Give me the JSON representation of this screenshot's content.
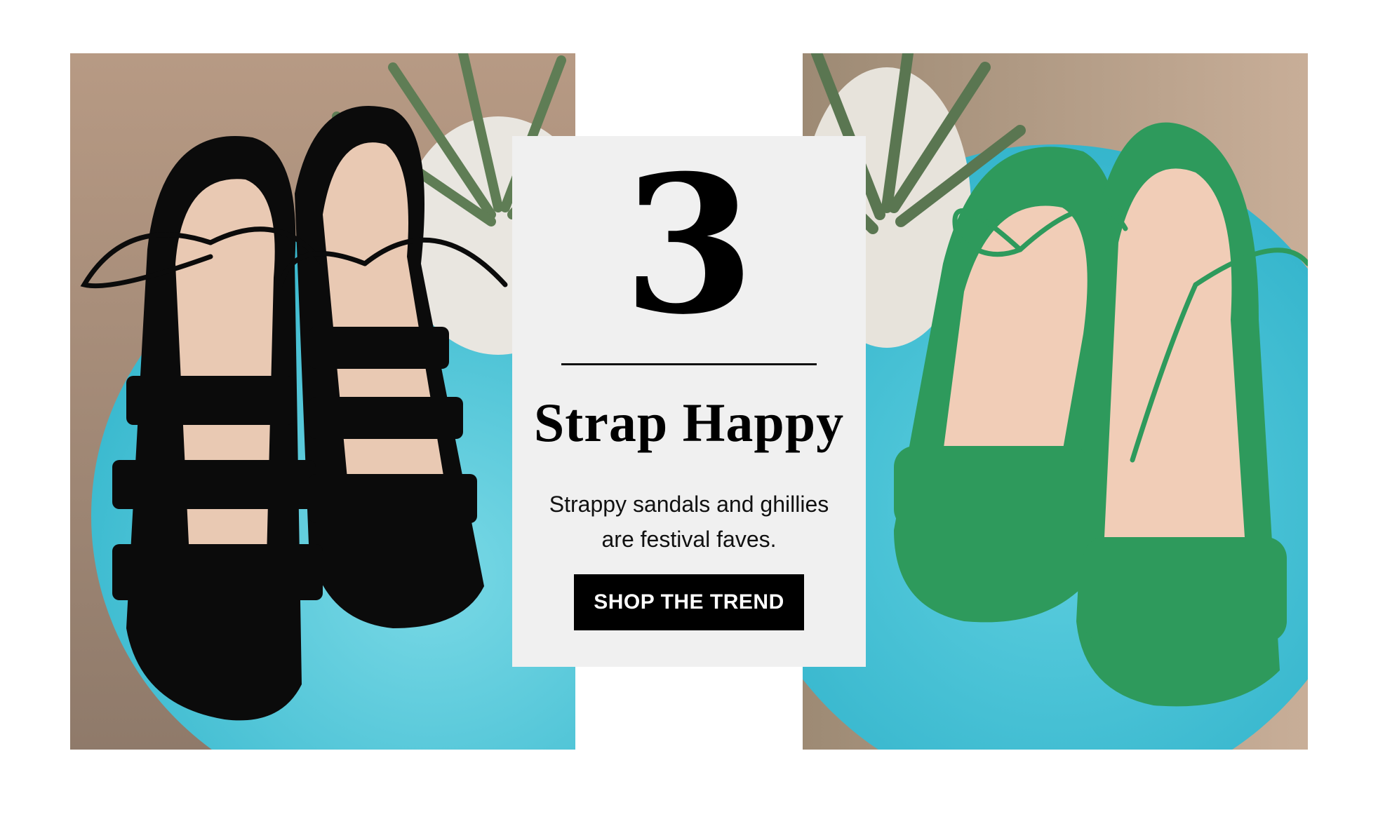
{
  "feature": {
    "number": "3",
    "title": "Strap Happy",
    "description_line1": "Strappy sandals and ghillies",
    "description_line2": "are festival faves.",
    "cta_label": "SHOP THE TREND"
  },
  "colors": {
    "card_background": "#f0f0f0",
    "button_background": "#000000",
    "button_text": "#ffffff",
    "table_turquoise": "#3cc0d4",
    "sandal_black": "#0b0b0b",
    "sandal_green": "#2e9a5c"
  },
  "images": {
    "left": "black-lace-up-sandals-photo",
    "right": "green-lace-up-sandals-photo"
  }
}
